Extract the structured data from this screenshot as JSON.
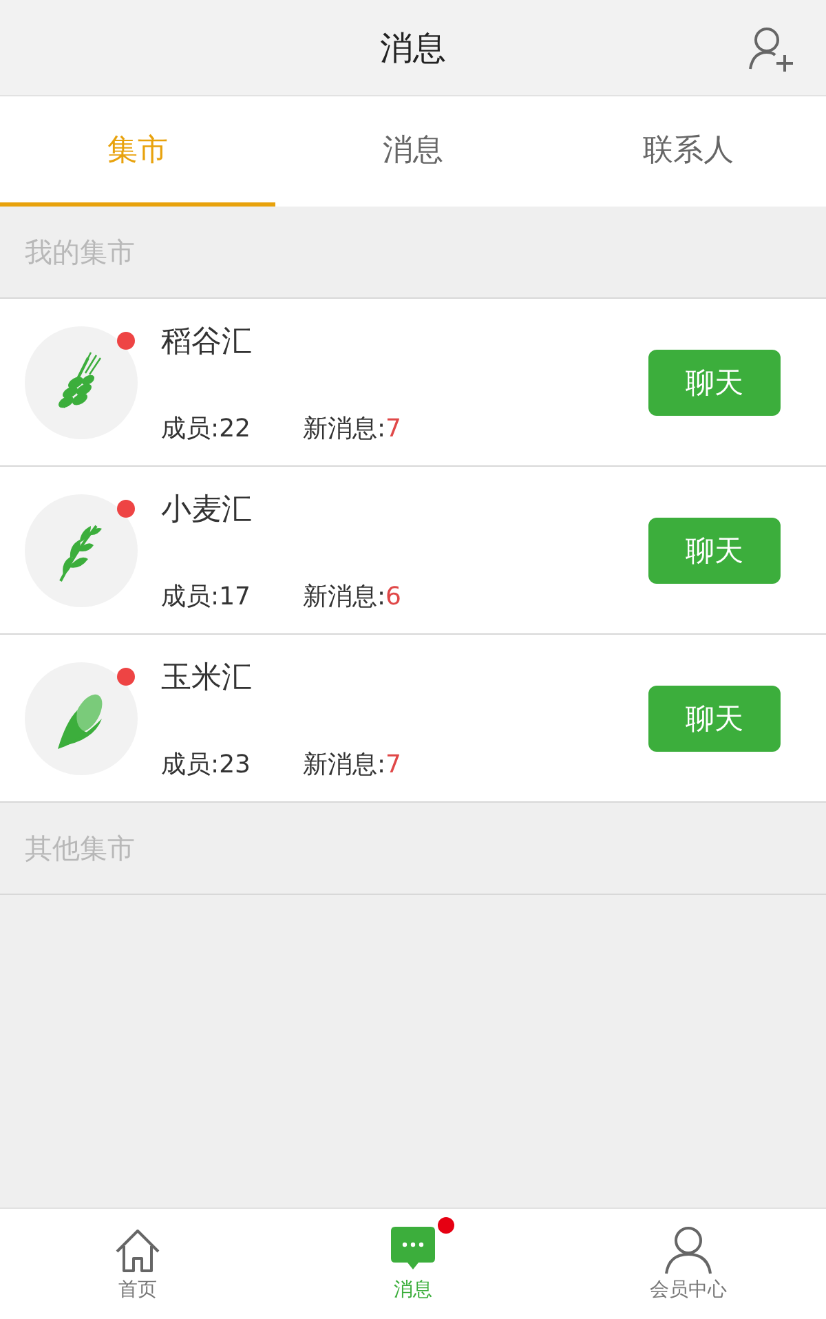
{
  "header": {
    "title": "消息"
  },
  "tabs": [
    {
      "label": "集市",
      "selected": true
    },
    {
      "label": "消息",
      "selected": false
    },
    {
      "label": "联系人",
      "selected": false
    }
  ],
  "sections": [
    {
      "title": "我的集市",
      "markets": [
        {
          "kind": "rice",
          "name": "稻谷汇",
          "unread": true,
          "members": "成员:22",
          "new_label": "新消息:",
          "new_count": "7",
          "button": "聊天"
        },
        {
          "kind": "wheat",
          "name": "小麦汇",
          "unread": true,
          "members": "成员:17",
          "new_label": "新消息:",
          "new_count": "6",
          "button": "聊天"
        },
        {
          "kind": "corn",
          "name": "玉米汇",
          "unread": true,
          "members": "成员:23",
          "new_label": "新消息:",
          "new_count": "7",
          "button": "聊天"
        }
      ]
    },
    {
      "title": "其他集市"
    }
  ],
  "nav": [
    {
      "kind": "home",
      "label": "首页",
      "selected": false,
      "badge": false
    },
    {
      "kind": "chat",
      "label": "消息",
      "selected": true,
      "badge": true
    },
    {
      "kind": "user",
      "label": "会员中心",
      "selected": false,
      "badge": false
    }
  ]
}
